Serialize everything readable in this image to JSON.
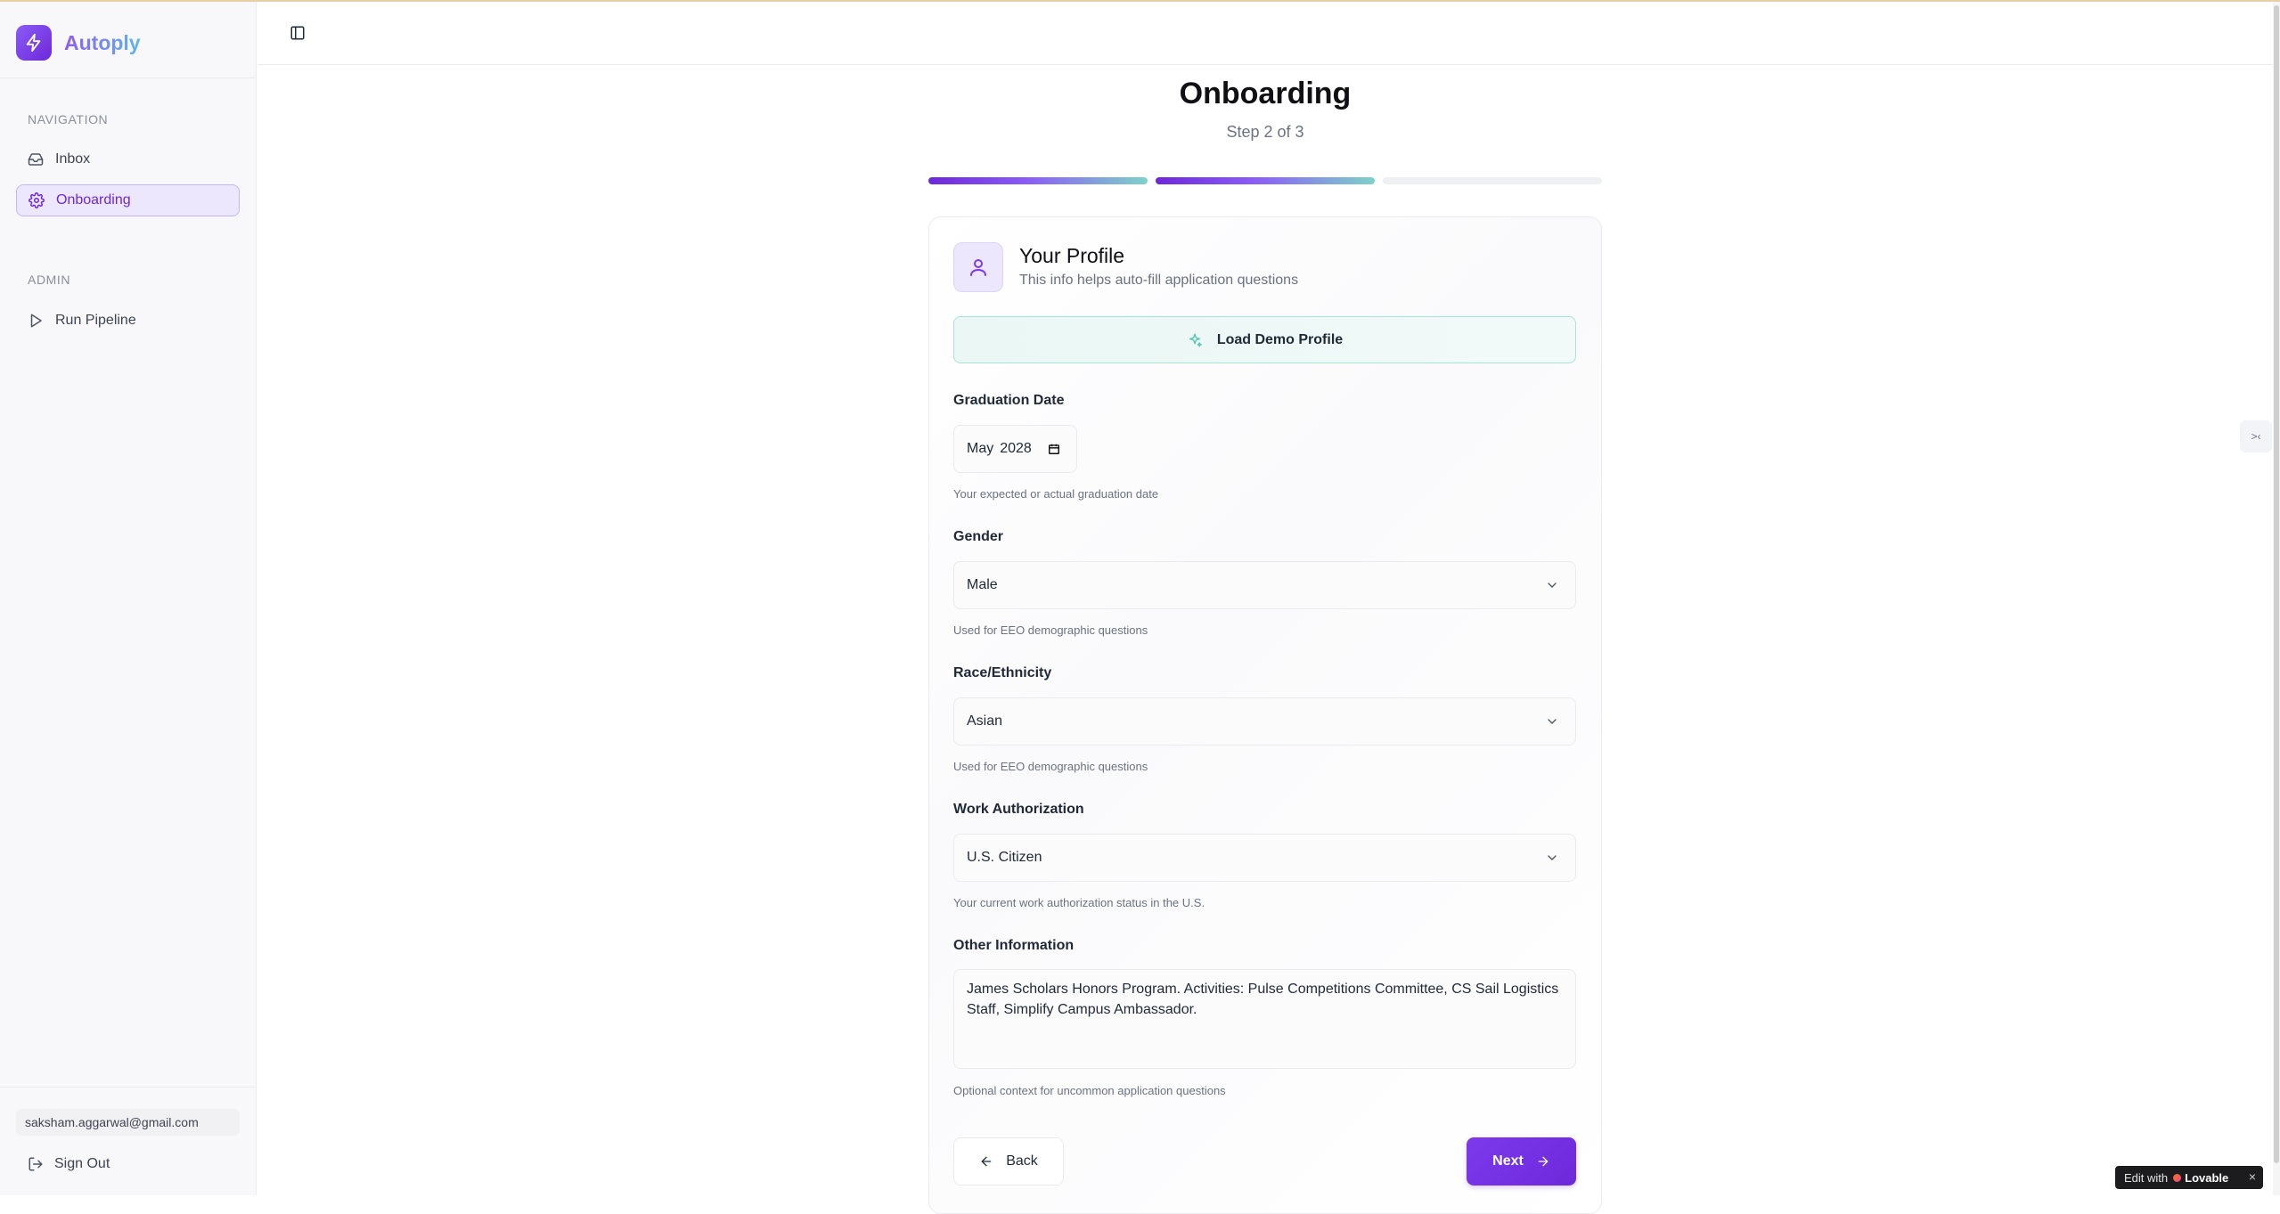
{
  "app": {
    "name": "Autoply"
  },
  "sidebar": {
    "section_navigation": "NAVIGATION",
    "section_admin": "ADMIN",
    "items": [
      {
        "label": "Inbox",
        "icon": "inbox-icon"
      },
      {
        "label": "Onboarding",
        "icon": "gear-icon",
        "active": true
      },
      {
        "label": "Run Pipeline",
        "icon": "play-icon"
      }
    ],
    "user_email": "saksham.aggarwal@gmail.com",
    "sign_out": "Sign Out"
  },
  "page": {
    "title": "Onboarding",
    "step_text": "Step 2 of 3",
    "steps_total": 3,
    "steps_completed": 2
  },
  "card": {
    "title": "Your Profile",
    "subtitle": "This info helps auto-fill application questions",
    "demo_button": "Load Demo Profile",
    "fields": {
      "graduation": {
        "label": "Graduation Date",
        "month": "May",
        "year": "2028",
        "hint": "Your expected or actual graduation date"
      },
      "gender": {
        "label": "Gender",
        "value": "Male",
        "hint": "Used for EEO demographic questions"
      },
      "race": {
        "label": "Race/Ethnicity",
        "value": "Asian",
        "hint": "Used for EEO demographic questions"
      },
      "work_auth": {
        "label": "Work Authorization",
        "value": "U.S. Citizen",
        "hint": "Your current work authorization status in the U.S."
      },
      "other": {
        "label": "Other Information",
        "value": "James Scholars Honors Program. Activities: Pulse Competitions Committee, CS Sail Logistics Staff, Simplify Campus Ambassador.",
        "hint": "Optional context for uncommon application questions"
      }
    },
    "back": "Back",
    "next": "Next"
  },
  "side_tab": ">‹",
  "badge": {
    "prefix": "Edit with",
    "brand": "Lovable",
    "close": "×"
  },
  "colors": {
    "accent": "#6d28d9",
    "teal": "#7dd3c8"
  }
}
